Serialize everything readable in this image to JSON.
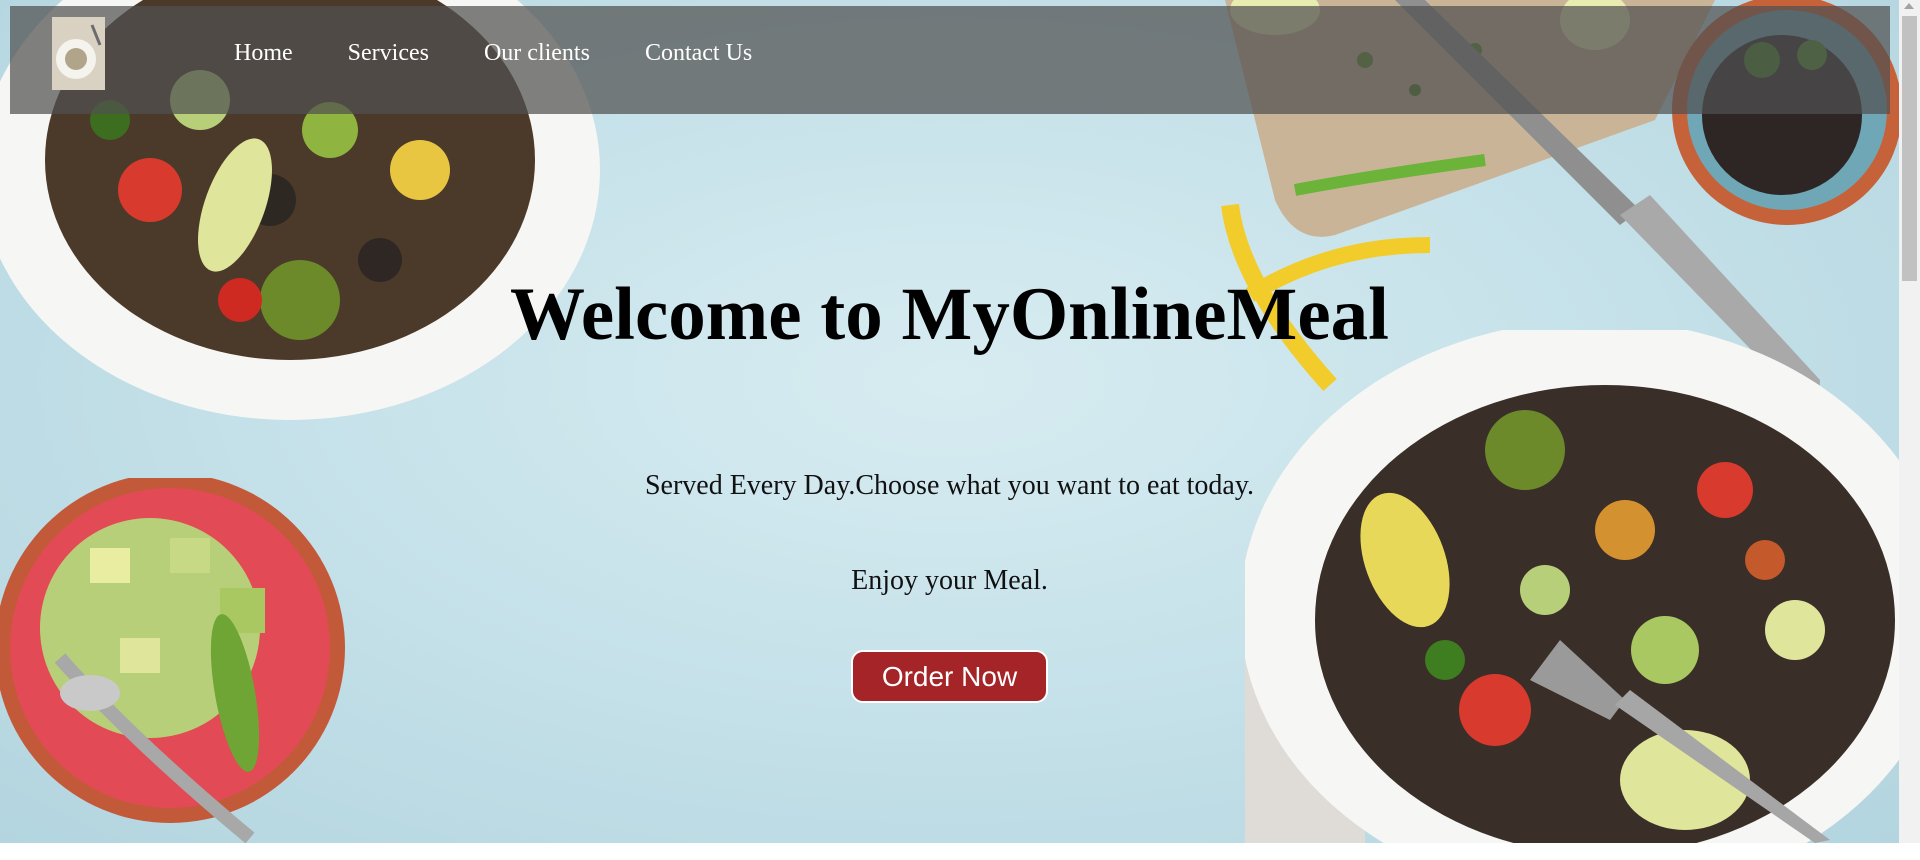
{
  "nav": {
    "links": [
      "Home",
      "Services",
      "Our clients",
      "Contact Us"
    ]
  },
  "hero": {
    "title": "Welcome to MyOnlineMeal",
    "subtitle": "Served Every Day.Choose what you want to eat today.",
    "tagline": "Enjoy your Meal.",
    "button": "Order Now"
  },
  "colors": {
    "navbar": "#505050",
    "button": "#a42427",
    "background": "#c7e2ea"
  },
  "icons": [
    "logo-icon",
    "salad-bowl-image",
    "avocado-bowl-image",
    "bean-salad-plate-image",
    "cutting-board-image",
    "knife-image",
    "black-beans-bowl-image",
    "fork-image"
  ]
}
